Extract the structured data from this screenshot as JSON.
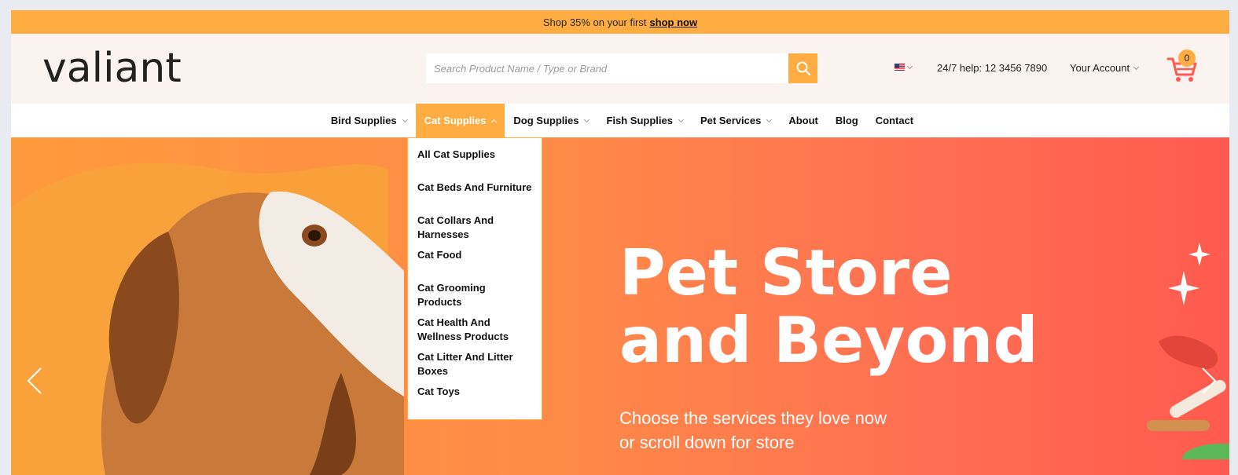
{
  "topbar": {
    "text": "Shop 35% on your first",
    "link": "shop now"
  },
  "header": {
    "logo": "valiant",
    "search_placeholder": "Search Product Name / Type or Brand",
    "help": "24/7 help: 12 3456 7890",
    "account": "Your Account",
    "cart_count": "0"
  },
  "nav": {
    "items": [
      {
        "label": "Bird Supplies",
        "has_menu": true
      },
      {
        "label": "Cat Supplies",
        "has_menu": true,
        "active": true
      },
      {
        "label": "Dog Supplies",
        "has_menu": true
      },
      {
        "label": "Fish Supplies",
        "has_menu": true
      },
      {
        "label": "Pet Services",
        "has_menu": true
      },
      {
        "label": "About"
      },
      {
        "label": "Blog"
      },
      {
        "label": "Contact"
      }
    ]
  },
  "dropdown": {
    "items": [
      "All Cat Supplies",
      "Cat Beds And Furniture",
      "Cat Collars And Harnesses",
      "Cat Food",
      "Cat Grooming Products",
      "Cat Health And Wellness Products",
      "Cat Litter And Litter Boxes",
      "Cat Toys"
    ]
  },
  "hero": {
    "title_line1": "Pet Store",
    "title_line2": "and Beyond",
    "sub_line1": "Choose the services they love now",
    "sub_line2": "or scroll down for store"
  },
  "colors": {
    "accent": "#ffad42",
    "hero_start": "#ff9a3c",
    "hero_end": "#ff5a4f",
    "header_bg": "#fbf3ef"
  }
}
